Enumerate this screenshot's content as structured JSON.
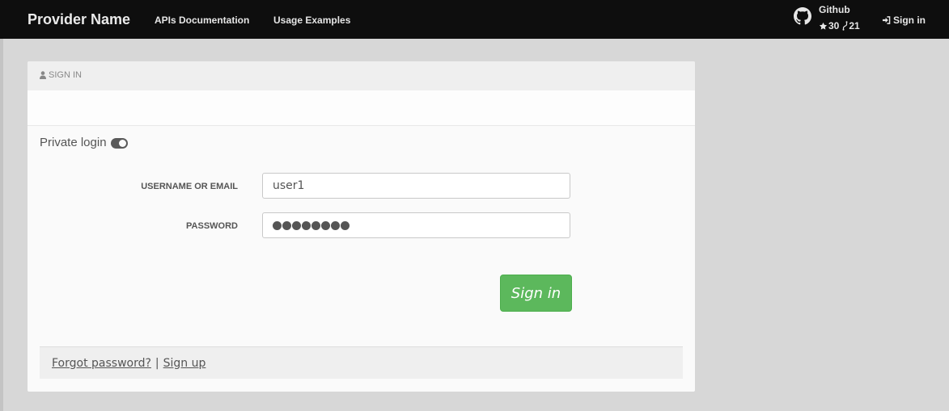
{
  "navbar": {
    "brand": "Provider Name",
    "links": [
      {
        "label": "APIs Documentation"
      },
      {
        "label": "Usage Examples"
      }
    ],
    "github": {
      "title": "Github",
      "stars": "30",
      "forks": "21"
    },
    "signin_label": "Sign in"
  },
  "panel": {
    "header_label": "SIGN IN",
    "private_login_label": "Private login",
    "username_label": "USERNAME OR EMAIL",
    "username_value": "user1",
    "password_label": "PASSWORD",
    "password_length": 8,
    "signin_button": "Sign in",
    "forgot_label": "Forgot password?",
    "separator": "|",
    "signup_label": "Sign up"
  },
  "colors": {
    "navbar_bg": "#0e0e0e",
    "page_bg": "#d7d7d7",
    "button_green": "#5cb85c"
  }
}
